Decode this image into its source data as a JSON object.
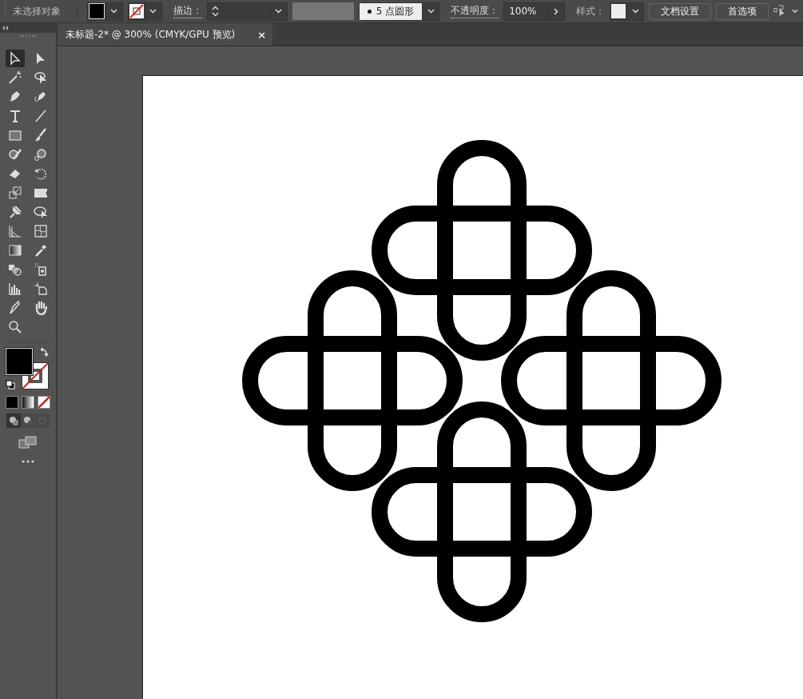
{
  "control_bar": {
    "selection": "未选择对象",
    "stroke_label": "描边：",
    "brush_profile": "5 点圆形",
    "opacity_label": "不透明度：",
    "opacity": "100%",
    "style_label": "样式：",
    "buttons": [
      "文档设置",
      "首选项"
    ]
  },
  "document_tab": {
    "title": "未标题-2* @ 300% (CMYK/GPU 预览)",
    "close": "×"
  },
  "tools": [
    {
      "kind": "select",
      "selected": true
    },
    {
      "kind": "directselect",
      "selected": false
    },
    {
      "kind": "wand",
      "selected": false
    },
    {
      "kind": "lasso",
      "selected": false
    },
    {
      "kind": "pen",
      "selected": false
    },
    {
      "kind": "curvature",
      "selected": false
    },
    {
      "kind": "type",
      "selected": false
    },
    {
      "kind": "line",
      "selected": false
    },
    {
      "kind": "rectangle",
      "selected": false
    },
    {
      "kind": "paintbrush",
      "selected": false
    },
    {
      "kind": "shaper",
      "selected": false
    },
    {
      "kind": "blob",
      "selected": false
    },
    {
      "kind": "eraser",
      "selected": false
    },
    {
      "kind": "rotate",
      "selected": false
    },
    {
      "kind": "scale",
      "selected": false
    },
    {
      "kind": "width",
      "selected": false
    },
    {
      "kind": "puppet",
      "selected": false
    },
    {
      "kind": "freetransform",
      "selected": false
    },
    {
      "kind": "perspective",
      "selected": false
    },
    {
      "kind": "mesh",
      "selected": false
    },
    {
      "kind": "gradient",
      "selected": false
    },
    {
      "kind": "eyedropper",
      "selected": false
    },
    {
      "kind": "blend",
      "selected": false
    },
    {
      "kind": "sprayer",
      "selected": false
    },
    {
      "kind": "graph",
      "selected": false
    },
    {
      "kind": "artboard",
      "selected": false
    },
    {
      "kind": "slice",
      "selected": false
    },
    {
      "kind": "hand",
      "selected": false
    },
    {
      "kind": "zoom",
      "selected": false
    }
  ]
}
